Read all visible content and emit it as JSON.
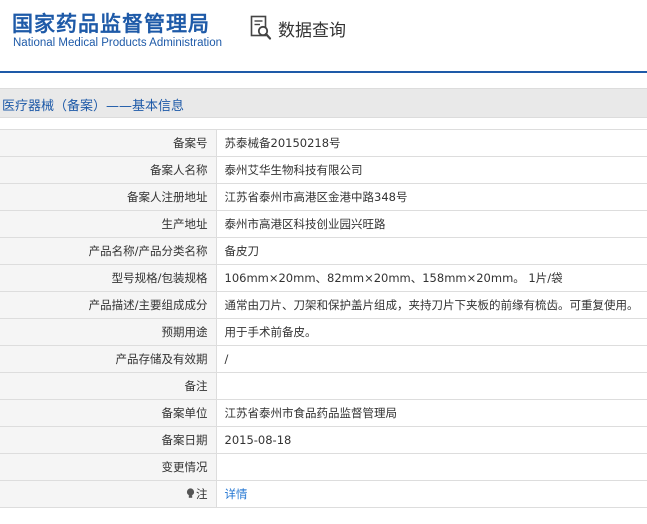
{
  "header": {
    "logo_cn": "国家药品监督管理局",
    "logo_en": "National Medical Products Administration",
    "search_label": "数据查询",
    "accent_color": "#1e5aa8"
  },
  "section": {
    "title": "医疗器械（备案）——基本信息"
  },
  "rows": [
    {
      "label": "备案号",
      "value": "苏泰械备20150218号"
    },
    {
      "label": "备案人名称",
      "value": "泰州艾华生物科技有限公司"
    },
    {
      "label": "备案人注册地址",
      "value": "江苏省泰州市高港区金港中路348号"
    },
    {
      "label": "生产地址",
      "value": "泰州市高港区科技创业园兴旺路"
    },
    {
      "label": "产品名称/产品分类名称",
      "value": "备皮刀"
    },
    {
      "label": "型号规格/包装规格",
      "value": "106mm×20mm、82mm×20mm、158mm×20mm。 1片/袋"
    },
    {
      "label": "产品描述/主要组成成分",
      "value": "通常由刀片、刀架和保护盖片组成，夹持刀片下夹板的前缘有梳齿。可重复使用。"
    },
    {
      "label": "预期用途",
      "value": "用于手术前备皮。"
    },
    {
      "label": "产品存储及有效期",
      "value": "/"
    },
    {
      "label": "备注",
      "value": ""
    },
    {
      "label": "备案单位",
      "value": "江苏省泰州市食品药品监督管理局"
    },
    {
      "label": "备案日期",
      "value": "2015-08-18"
    },
    {
      "label": "变更情况",
      "value": ""
    }
  ],
  "note_row": {
    "icon": "lightbulb-icon",
    "label": "注",
    "link_text": "详情"
  }
}
